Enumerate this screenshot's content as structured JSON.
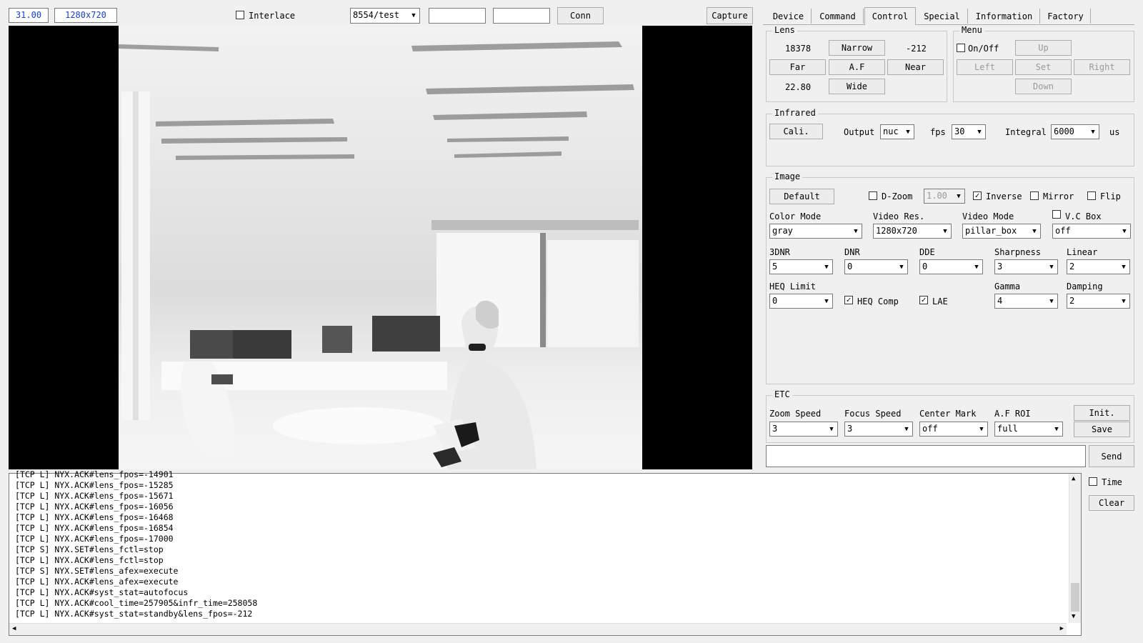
{
  "topbar": {
    "fps_value": "31.00",
    "resolution_value": "1280x720",
    "interlace_label": "Interlace",
    "interlace_checked": false,
    "address_select": "8554/test",
    "field1": "",
    "field2": "",
    "conn_label": "Conn",
    "capture_label": "Capture"
  },
  "tabs": [
    {
      "label": "Device"
    },
    {
      "label": "Command"
    },
    {
      "label": "Control"
    },
    {
      "label": "Special"
    },
    {
      "label": "Information"
    },
    {
      "label": "Factory"
    }
  ],
  "lens": {
    "legend": "Lens",
    "zoom_pos": "18378",
    "focus_pos": "-212",
    "fov": "22.80",
    "narrow": "Narrow",
    "far": "Far",
    "af": "A.F",
    "near": "Near",
    "wide": "Wide"
  },
  "menu": {
    "legend": "Menu",
    "onoff_label": "On/Off",
    "up": "Up",
    "left": "Left",
    "set": "Set",
    "right": "Right",
    "down": "Down"
  },
  "infrared": {
    "legend": "Infrared",
    "cali": "Cali.",
    "output_label": "Output",
    "output_value": "nuc",
    "fps_label": "fps",
    "fps_value": "30",
    "integral_label": "Integral",
    "integral_value": "6000",
    "unit": "us"
  },
  "image": {
    "legend": "Image",
    "default_label": "Default",
    "dzoom_label": "D-Zoom",
    "dzoom_value": "1.00",
    "inverse_label": "Inverse",
    "mirror_label": "Mirror",
    "flip_label": "Flip",
    "color_mode_label": "Color Mode",
    "color_mode_value": "gray",
    "video_res_label": "Video Res.",
    "video_res_value": "1280x720",
    "video_mode_label": "Video Mode",
    "video_mode_value": "pillar_box",
    "vc_box_label": "V.C Box",
    "vc_box_value": "off",
    "dnr3_label": "3DNR",
    "dnr3_value": "5",
    "dnr_label": "DNR",
    "dnr_value": "0",
    "dde_label": "DDE",
    "dde_value": "0",
    "sharpness_label": "Sharpness",
    "sharpness_value": "3",
    "linear_label": "Linear",
    "linear_value": "2",
    "heq_limit_label": "HEQ Limit",
    "heq_limit_value": "0",
    "heq_comp_label": "HEQ Comp",
    "lae_label": "LAE",
    "gamma_label": "Gamma",
    "gamma_value": "4",
    "damping_label": "Damping",
    "damping_value": "2"
  },
  "etc": {
    "legend": "ETC",
    "zoom_speed_label": "Zoom Speed",
    "zoom_speed_value": "3",
    "focus_speed_label": "Focus Speed",
    "focus_speed_value": "3",
    "center_mark_label": "Center Mark",
    "center_mark_value": "off",
    "af_roi_label": "A.F ROI",
    "af_roi_value": "full",
    "init": "Init.",
    "save": "Save"
  },
  "command": {
    "input_value": "",
    "send": "Send"
  },
  "log": {
    "time_label": "Time",
    "clear": "Clear",
    "lines": [
      "[TCP L] NYX.ACK#lens_fpos=-14901",
      "[TCP L] NYX.ACK#lens_fpos=-15285",
      "[TCP L] NYX.ACK#lens_fpos=-15671",
      "[TCP L] NYX.ACK#lens_fpos=-16056",
      "[TCP L] NYX.ACK#lens_fpos=-16468",
      "[TCP L] NYX.ACK#lens_fpos=-16854",
      "[TCP L] NYX.ACK#lens_fpos=-17000",
      "[TCP S] NYX.SET#lens_fctl=stop",
      "[TCP L] NYX.ACK#lens_fctl=stop",
      "[TCP S] NYX.SET#lens_afex=execute",
      "[TCP L] NYX.ACK#lens_afex=execute",
      "[TCP L] NYX.ACK#syst_stat=autofocus",
      "[TCP L] NYX.ACK#cool_time=257905&infr_time=258058",
      "[TCP L] NYX.ACK#syst_stat=standby&lens_fpos=-212"
    ]
  }
}
